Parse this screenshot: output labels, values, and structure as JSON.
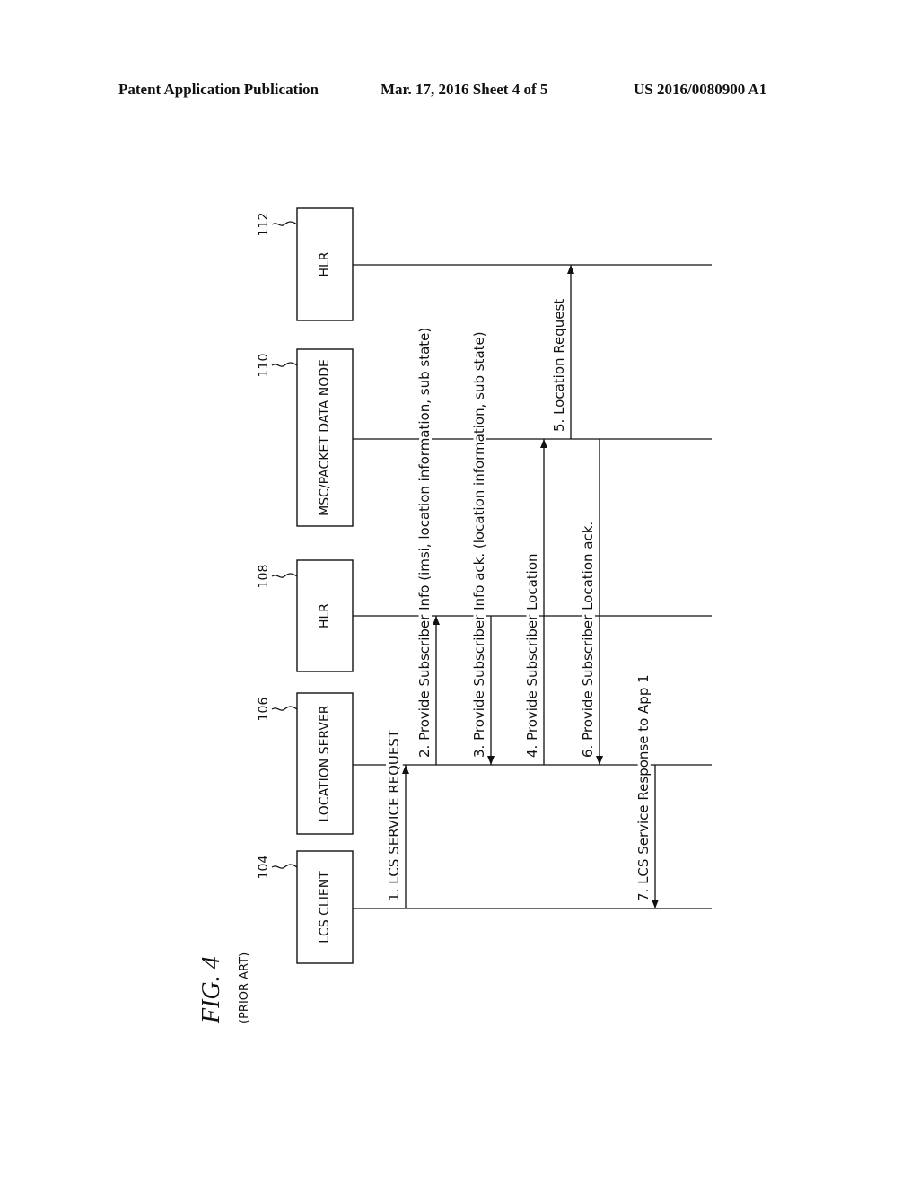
{
  "header": {
    "publication": "Patent Application Publication",
    "date_sheet": "Mar. 17, 2016  Sheet 4 of 5",
    "number": "US 2016/0080900 A1"
  },
  "figure": {
    "title": "FIG.  4",
    "subtitle": "(PRIOR ART)"
  },
  "entities": [
    {
      "ref": "104",
      "label": "LCS CLIENT"
    },
    {
      "ref": "106",
      "label": "LOCATION SERVER"
    },
    {
      "ref": "108",
      "label": "HLR"
    },
    {
      "ref": "110",
      "label": "MSC/PACKET DATA NODE"
    },
    {
      "ref": "112",
      "label": "HLR"
    }
  ],
  "messages": [
    {
      "label": "1. LCS SERVICE REQUEST",
      "from": 0,
      "to": 1
    },
    {
      "label": "2. Provide Subscriber Info (imsi, location information, sub state)",
      "from": 1,
      "to": 2
    },
    {
      "label": "3. Provide Subscriber Info ack. (location information, sub state)",
      "from": 2,
      "to": 1
    },
    {
      "label": "4. Provide Subscriber Location",
      "from": 1,
      "to": 3
    },
    {
      "label": "5. Location Request",
      "from": 3,
      "to": 4
    },
    {
      "label": "6. Provide Subscriber Location ack.",
      "from": 3,
      "to": 1
    },
    {
      "label": "7. LCS Service Response to App 1",
      "from": 1,
      "to": 0
    }
  ]
}
